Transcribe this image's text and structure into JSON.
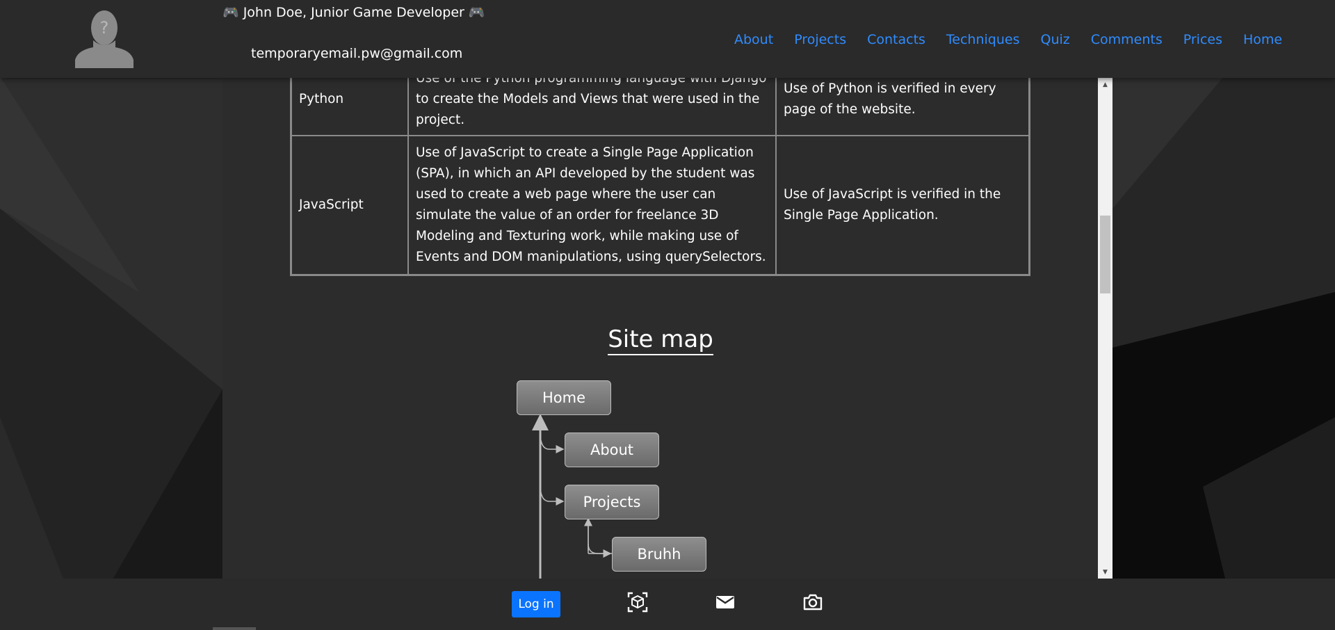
{
  "header": {
    "title": "🎮 John Doe, Junior Game Developer 🎮",
    "email": "temporaryemail.pw@gmail.com",
    "avatar_icon": "person-placeholder-icon",
    "nav": [
      {
        "label": "About"
      },
      {
        "label": "Projects"
      },
      {
        "label": "Contacts"
      },
      {
        "label": "Techniques"
      },
      {
        "label": "Quiz"
      },
      {
        "label": "Comments"
      },
      {
        "label": "Prices"
      },
      {
        "label": "Home"
      }
    ]
  },
  "techniques_table": {
    "rows": [
      {
        "tech": "Python",
        "description": "Use of the Python programming language with Django to create the Models and Views that were used in the project.",
        "verification": "Use of Python is verified in every page of the website."
      },
      {
        "tech": "JavaScript",
        "description": "Use of JavaScript to create a Single Page Application (SPA), in which an API developed by the student was used to create a web page where the user can simulate the value of an order for freelance 3D Modeling and Texturing work, while making use of Events and DOM manipulations, using querySelectors.",
        "verification": "Use of JavaScript is verified in the Single Page Application."
      }
    ]
  },
  "sitemap": {
    "title": "Site map",
    "nodes": {
      "home": "Home",
      "about": "About",
      "projects": "Projects",
      "bruhh": "Bruhh"
    }
  },
  "footer": {
    "login_label": "Log in",
    "icons": [
      "3d-box-icon",
      "mail-icon",
      "camera-icon"
    ]
  },
  "colors": {
    "nav_link": "#2f8cff",
    "login_button": "#0a74ff",
    "header_bg": "#2a2a2a",
    "panel_bg": "#2c2c2c"
  }
}
